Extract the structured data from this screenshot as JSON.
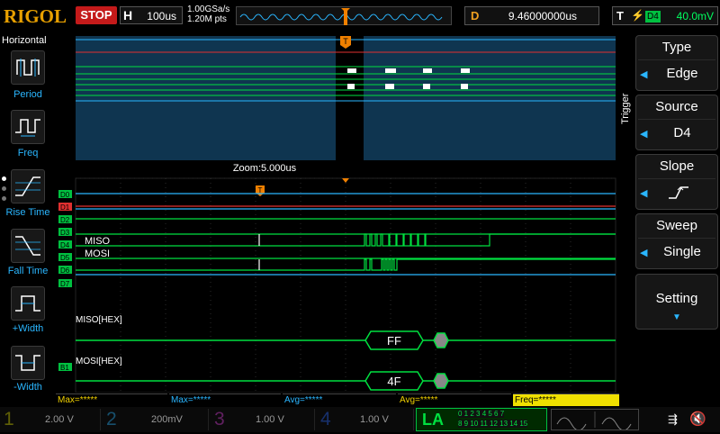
{
  "brand": "RIGOL",
  "run_state": "STOP",
  "timebase": {
    "key": "H",
    "value": "100us"
  },
  "acquisition": {
    "sample_rate": "1.00GSa/s",
    "mem_depth": "1.20M pts"
  },
  "delay": {
    "key": "D",
    "value": "9.46000000us"
  },
  "trigger_status": {
    "key": "T",
    "icon": "edge-rising-icon",
    "source": "D4",
    "level": "40.0mV"
  },
  "left_menu": {
    "title": "Horizontal",
    "items": [
      {
        "label": "Period",
        "icon": "period-icon"
      },
      {
        "label": "Freq",
        "icon": "freq-icon"
      },
      {
        "label": "Rise Time",
        "icon": "rise-time-icon"
      },
      {
        "label": "Fall Time",
        "icon": "fall-time-icon"
      },
      {
        "label": "+Width",
        "icon": "pos-width-icon"
      },
      {
        "label": "-Width",
        "icon": "neg-width-icon"
      }
    ]
  },
  "right_menu": {
    "header": "Trigger",
    "items": [
      {
        "title": "Type",
        "value": "Edge"
      },
      {
        "title": "Source",
        "value": "D4"
      },
      {
        "title": "Slope",
        "value": ""
      },
      {
        "title": "Sweep",
        "value": "Single"
      },
      {
        "title": "Setting",
        "value": ""
      }
    ]
  },
  "zoom_label": "Zoom:5.000us",
  "digital_channels": [
    "D0",
    "D1",
    "D2",
    "D3",
    "D4",
    "D5",
    "D6",
    "D7"
  ],
  "signal_labels": {
    "miso": "MISO",
    "mosi": "MOSI"
  },
  "bus": {
    "b1_marker": "B1",
    "miso_label": "MISO[HEX]",
    "miso_value": "FF",
    "mosi_label": "MOSI[HEX]",
    "mosi_value": "4F"
  },
  "trigger_marker": "T",
  "measurements": [
    {
      "text": "Max=*****",
      "color": "#f0d000"
    },
    {
      "text": "Max=*****",
      "color": "#2ab6ff"
    },
    {
      "text": "Avg=*****",
      "color": "#2ab6ff"
    },
    {
      "text": "Avg=*****",
      "color": "#f0d000"
    },
    {
      "text": "Freq=*****",
      "color": "#f0d000"
    }
  ],
  "channels": [
    {
      "num": "1",
      "scale": "2.00 V"
    },
    {
      "num": "2",
      "scale": "200mV"
    },
    {
      "num": "3",
      "scale": "1.00 V"
    },
    {
      "num": "4",
      "scale": "1.00 V"
    }
  ],
  "la": {
    "label": "LA",
    "bits_top": "0 1 2 3  4 5 6 7",
    "bits_bottom": "8 9 10 11  12 13 14 15"
  },
  "colors": {
    "accent_blue": "#2ab6ff",
    "digital_green": "#00e040",
    "trigger_orange": "#f08000",
    "stop_red": "#c41a1a",
    "wave_bg": "#0f3550"
  }
}
